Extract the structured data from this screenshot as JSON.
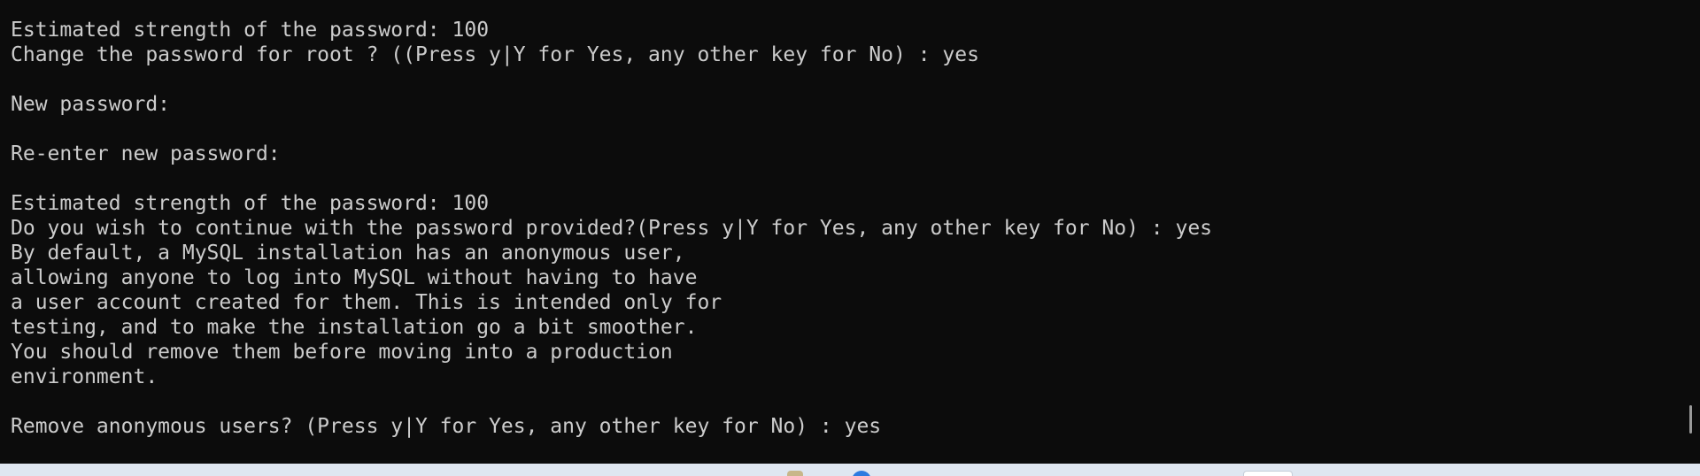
{
  "terminal": {
    "lines": [
      "Estimated strength of the password: 100",
      "Change the password for root ? ((Press y|Y for Yes, any other key for No) : yes",
      "",
      "New password:",
      "",
      "Re-enter new password:",
      "",
      "Estimated strength of the password: 100",
      "Do you wish to continue with the password provided?(Press y|Y for Yes, any other key for No) : yes",
      "By default, a MySQL installation has an anonymous user,",
      "allowing anyone to log into MySQL without having to have",
      "a user account created for them. This is intended only for",
      "testing, and to make the installation go a bit smoother.",
      "You should remove them before moving into a production",
      "environment.",
      "",
      "Remove anonymous users? (Press y|Y for Yes, any other key for No) : yes"
    ]
  },
  "taskbar": {
    "icons": [
      "file-explorer-icon",
      "edge-browser-icon",
      "store-icon"
    ]
  },
  "colors": {
    "background": "#0c0c0c",
    "foreground": "#cccccc",
    "taskbar": "#dfe7f1"
  }
}
